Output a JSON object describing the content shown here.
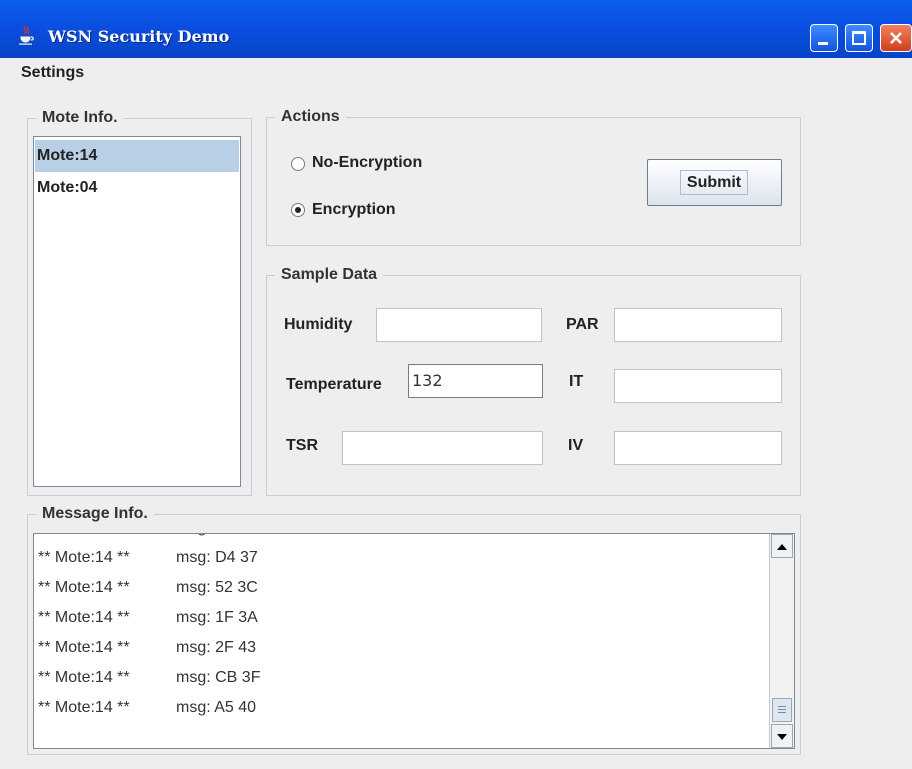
{
  "window": {
    "title": "WSN Security Demo",
    "icon": "java-coffee-icon"
  },
  "menubar": {
    "items": [
      "Settings"
    ]
  },
  "mote_info": {
    "title": "Mote Info.",
    "items": [
      {
        "label": "Mote:14",
        "selected": true
      },
      {
        "label": "Mote:04",
        "selected": false
      }
    ]
  },
  "actions": {
    "title": "Actions",
    "options": [
      {
        "label": "No-Encryption",
        "checked": false
      },
      {
        "label": "Encryption",
        "checked": true
      }
    ],
    "submit_label": "Submit"
  },
  "sample_data": {
    "title": "Sample Data",
    "fields": {
      "humidity": {
        "label": "Humidity",
        "value": ""
      },
      "par": {
        "label": "PAR",
        "value": ""
      },
      "temperature": {
        "label": "Temperature",
        "value": "132"
      },
      "it": {
        "label": "IT",
        "value": ""
      },
      "tsr": {
        "label": "TSR",
        "value": ""
      },
      "iv": {
        "label": "IV",
        "value": ""
      }
    }
  },
  "message_info": {
    "title": "Message Info.",
    "messages": [
      {
        "mote": "** Mote:14 **",
        "msg": "msg: D4 37"
      },
      {
        "mote": "** Mote:14 **",
        "msg": "msg: 52 3C"
      },
      {
        "mote": "** Mote:14 **",
        "msg": "msg: 1F 3A"
      },
      {
        "mote": "** Mote:14 **",
        "msg": "msg: 2F 43"
      },
      {
        "mote": "** Mote:14 **",
        "msg": "msg: CB 3F"
      },
      {
        "mote": "** Mote:14 **",
        "msg": "msg: A5 40"
      }
    ],
    "scrollbar": {
      "up_icon": "arrow-up-icon",
      "down_icon": "arrow-down-icon"
    }
  }
}
